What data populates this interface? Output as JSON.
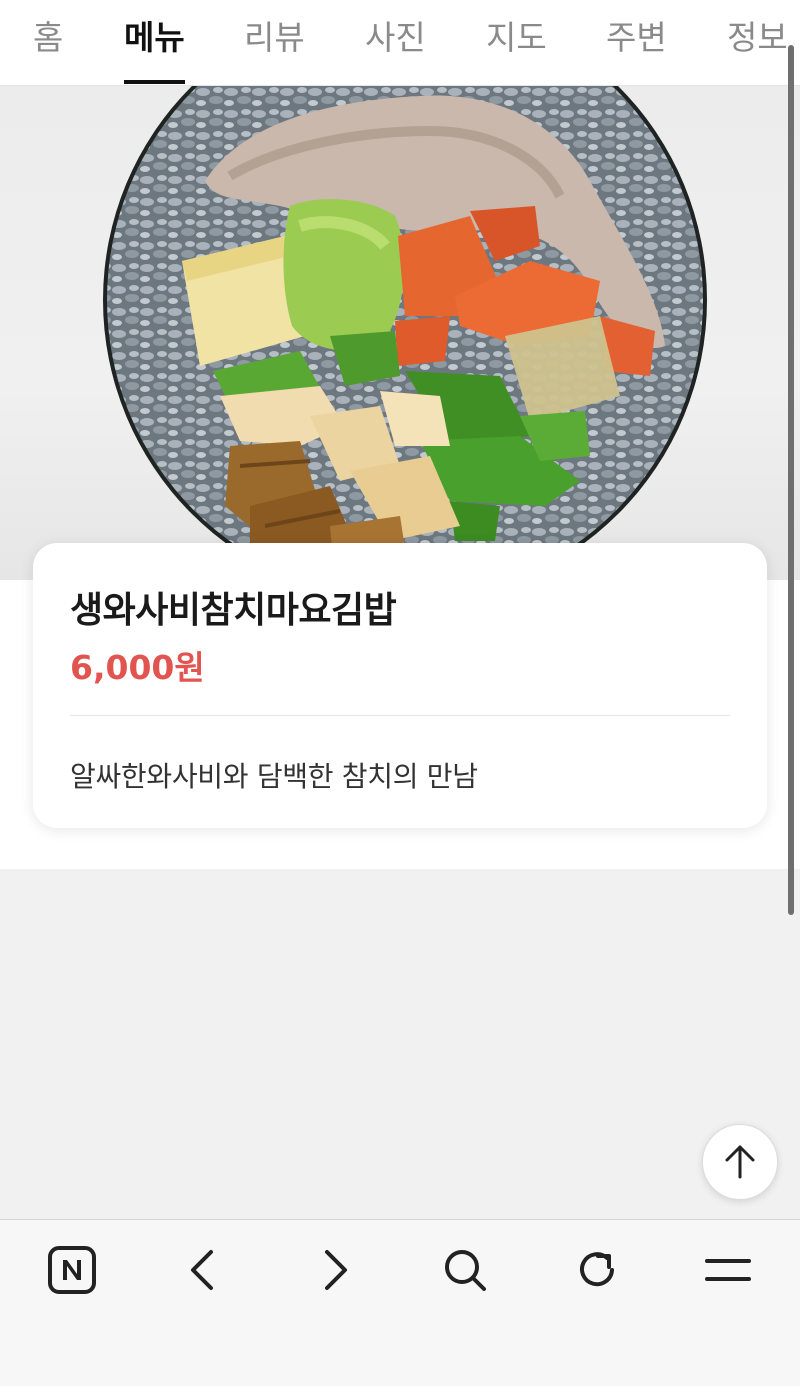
{
  "tabs": [
    {
      "label": "홈",
      "active": false
    },
    {
      "label": "메뉴",
      "active": true
    },
    {
      "label": "리뷰",
      "active": false
    },
    {
      "label": "사진",
      "active": false
    },
    {
      "label": "지도",
      "active": false
    },
    {
      "label": "주변",
      "active": false
    },
    {
      "label": "정보",
      "active": false
    }
  ],
  "menu_item": {
    "name": "생와사비참치마요김밥",
    "price": "6,000원",
    "description": "알싸한와사비와 담백한 참치의 만남"
  },
  "colors": {
    "price": "#e2544f",
    "active_tab": "#111111",
    "inactive_tab": "#8a8a8a"
  },
  "icons": {
    "scroll_top": "arrow-up-icon",
    "bottom_bar": [
      "naver-home-icon",
      "back-icon",
      "forward-icon",
      "search-icon",
      "refresh-icon",
      "menu-icon"
    ]
  }
}
